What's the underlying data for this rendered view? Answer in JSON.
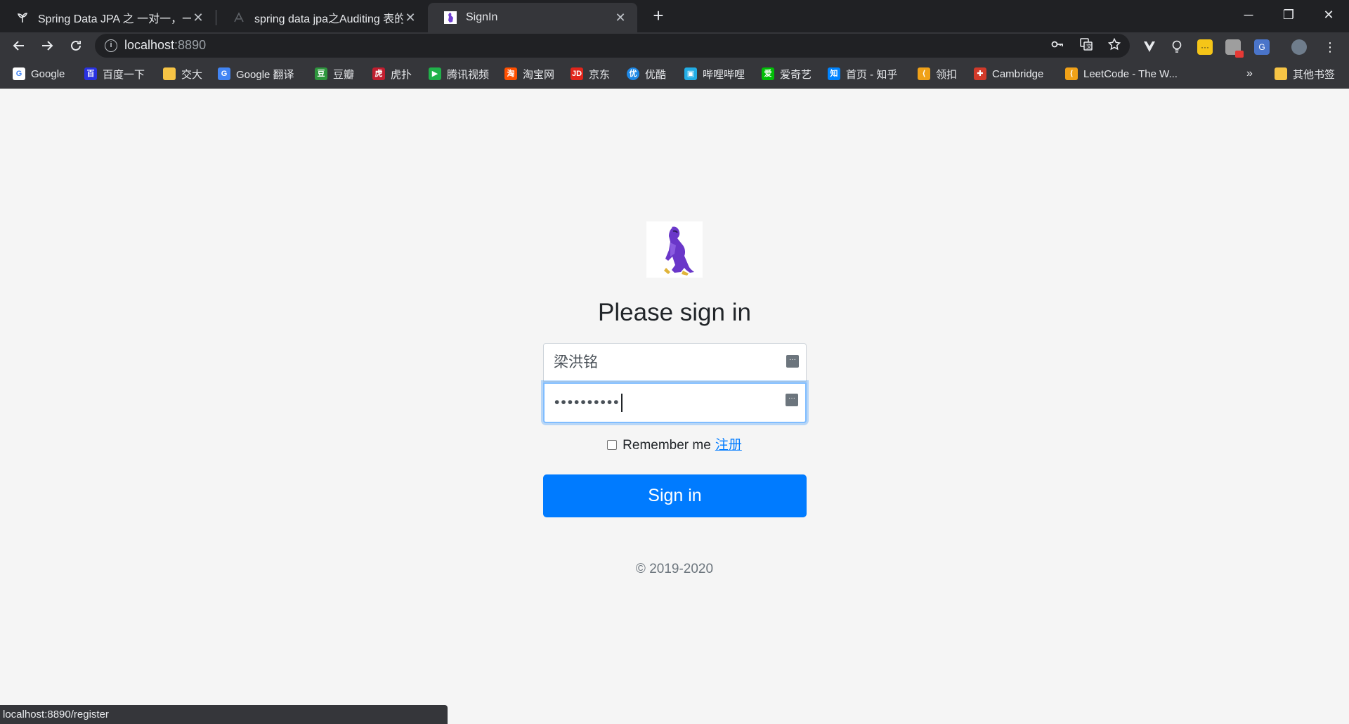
{
  "browser": {
    "tabs": [
      {
        "title": "Spring Data JPA 之 一对一，一对多",
        "favicon": "sprout-icon"
      },
      {
        "title": "spring data jpa之Auditing 表的",
        "favicon": "site-icon"
      },
      {
        "title": "SignIn",
        "favicon": "avatar-icon"
      }
    ],
    "new_tab": "+",
    "window_controls": {
      "minimize": "─",
      "restore": "❐",
      "close": "✕"
    },
    "address": {
      "host": "localhost",
      "port": ":8890"
    },
    "bookmarks": [
      {
        "label": "Google",
        "icon": "google-icon",
        "color": "#4285f4"
      },
      {
        "label": "百度一下",
        "icon": "baidu-icon",
        "color": "#2932e1"
      },
      {
        "label": "交大",
        "icon": "folder-icon",
        "color": "#f6c445"
      },
      {
        "label": "Google 翻译",
        "icon": "translate-icon",
        "color": "#4285f4"
      },
      {
        "label": "豆瓣",
        "icon": "douban-icon",
        "color": "#2e963d"
      },
      {
        "label": "虎扑",
        "icon": "hupu-icon",
        "color": "#c01e2f"
      },
      {
        "label": "腾讯视频",
        "icon": "tencent-video-icon",
        "color": "#20b14a"
      },
      {
        "label": "淘宝网",
        "icon": "taobao-icon",
        "color": "#ff5000"
      },
      {
        "label": "京东",
        "icon": "jd-icon",
        "color": "#e1251b"
      },
      {
        "label": "优酷",
        "icon": "youku-icon",
        "color": "#1e88e5"
      },
      {
        "label": "哔哩哔哩",
        "icon": "bilibili-icon",
        "color": "#23ade5"
      },
      {
        "label": "爱奇艺",
        "icon": "iqiyi-icon",
        "color": "#00be06"
      },
      {
        "label": "首页 - 知乎",
        "icon": "zhihu-icon",
        "color": "#0084ff"
      },
      {
        "label": "领扣",
        "icon": "leetcode-cn-icon",
        "color": "#f0a118"
      },
      {
        "label": "Cambridge",
        "icon": "cambridge-icon",
        "color": "#d13a2a"
      },
      {
        "label": "LeetCode - The W...",
        "icon": "leetcode-icon",
        "color": "#f0a118"
      }
    ],
    "bookmarks_more": "»",
    "other_bookmarks": "其他书签"
  },
  "page": {
    "heading": "Please sign in",
    "username_value": "梁洪铭",
    "password_mask": "••••••••••",
    "remember_label": "Remember me",
    "register_link": "注册",
    "signin_button": "Sign in",
    "copyright": "© 2019-2020"
  },
  "status_url": "localhost:8890/register",
  "colors": {
    "primary": "#007bff",
    "focus_border": "#80bdff",
    "page_bg": "#f5f5f5",
    "chrome_dark": "#202124",
    "chrome_toolbar": "#35363a"
  }
}
